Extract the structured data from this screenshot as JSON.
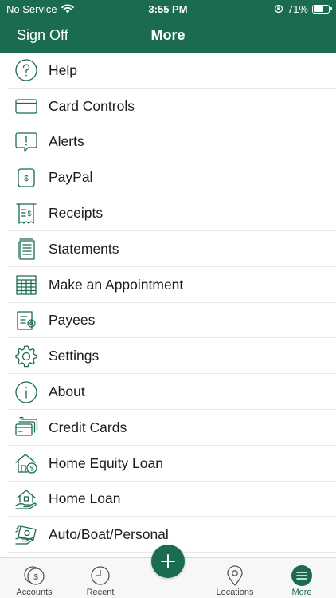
{
  "status_bar": {
    "carrier": "No Service",
    "time": "3:55 PM",
    "battery": "71%",
    "battery_level": 0.71
  },
  "nav": {
    "left_button": "Sign Off",
    "title": "More"
  },
  "menu": [
    {
      "label": "Help",
      "icon": "help-icon"
    },
    {
      "label": "Card Controls",
      "icon": "card-icon"
    },
    {
      "label": "Alerts",
      "icon": "alert-icon"
    },
    {
      "label": "PayPal",
      "icon": "paypal-icon"
    },
    {
      "label": "Receipts",
      "icon": "receipt-icon"
    },
    {
      "label": "Statements",
      "icon": "statement-icon"
    },
    {
      "label": "Make an Appointment",
      "icon": "calendar-icon"
    },
    {
      "label": "Payees",
      "icon": "payees-icon"
    },
    {
      "label": "Settings",
      "icon": "gear-icon"
    },
    {
      "label": "About",
      "icon": "info-icon"
    },
    {
      "label": "Credit Cards",
      "icon": "credit-cards-icon"
    },
    {
      "label": "Home Equity Loan",
      "icon": "home-equity-icon"
    },
    {
      "label": "Home Loan",
      "icon": "home-loan-icon"
    },
    {
      "label": "Auto/Boat/Personal",
      "icon": "money-icon"
    }
  ],
  "tabs": [
    {
      "label": "Accounts",
      "icon": "accounts-icon"
    },
    {
      "label": "Recent",
      "icon": "clock-icon"
    },
    {
      "label": "Locations",
      "icon": "location-pin-icon"
    },
    {
      "label": "More",
      "icon": "menu-icon",
      "active": true
    }
  ],
  "colors": {
    "brand": "#1a6b4f",
    "icon": "#1a6b4f"
  }
}
